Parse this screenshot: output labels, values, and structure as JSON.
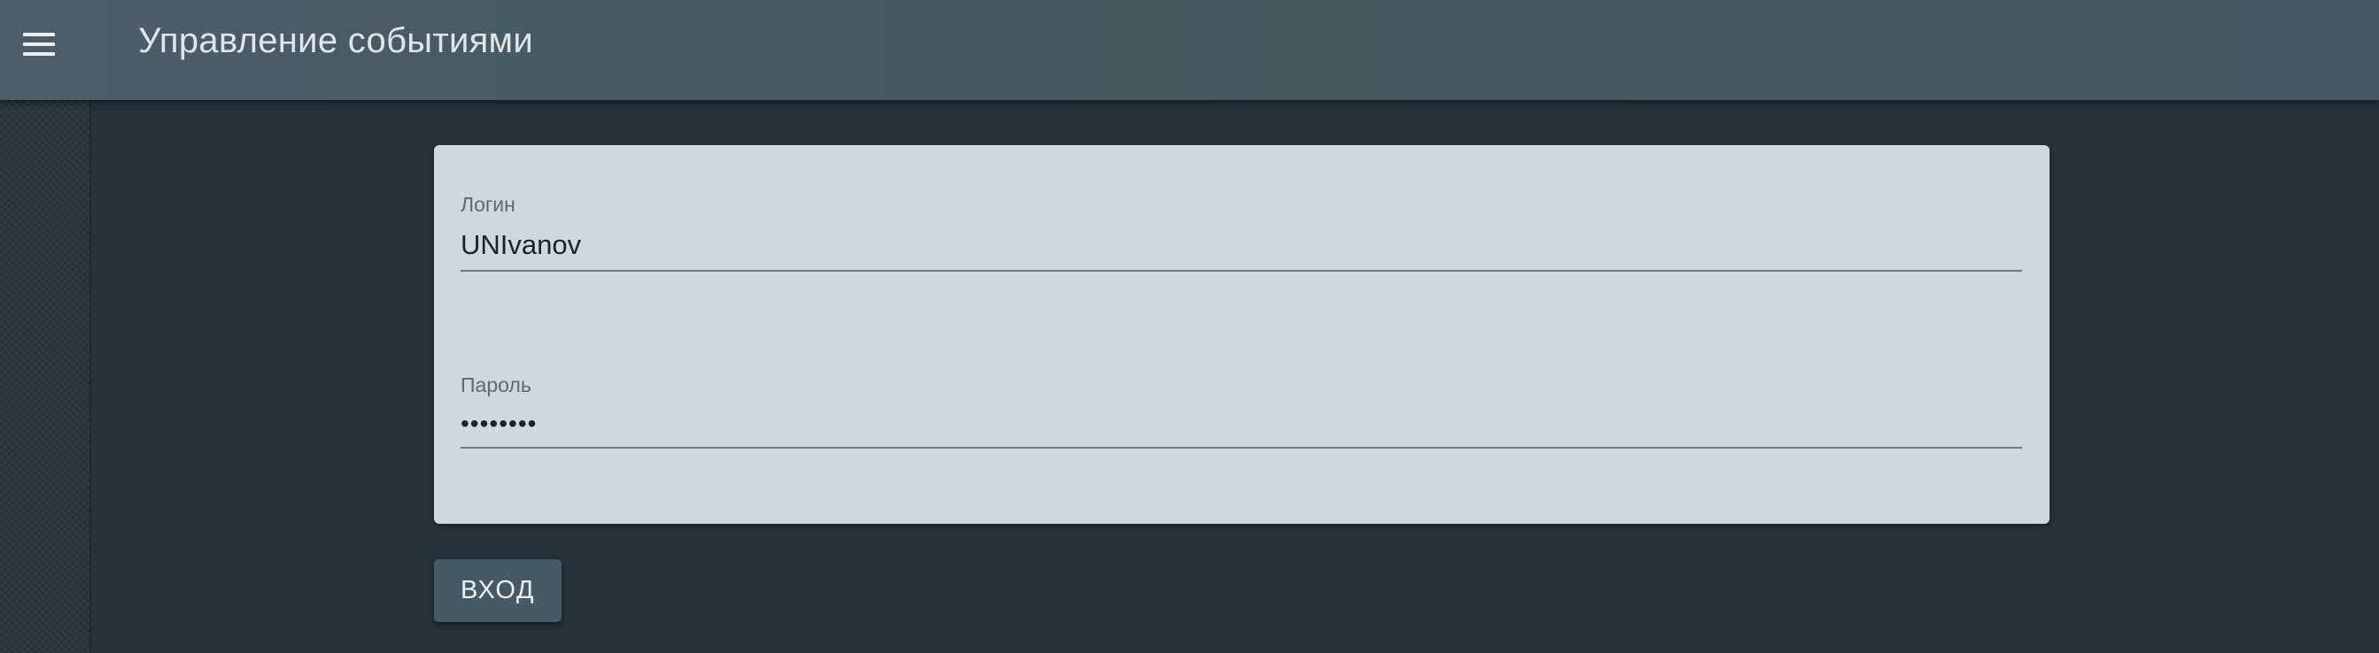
{
  "header": {
    "title": "Управление событиями",
    "menu_icon": "hamburger-menu-icon"
  },
  "login_form": {
    "login_label": "Логин",
    "login_value": "UNIvanov",
    "password_label": "Пароль",
    "password_value": "••••••••",
    "submit_label": "ВХОД"
  },
  "colors": {
    "app_bar": "#455a64",
    "background": "#263238",
    "card": "#cfd8dc",
    "button": "#455a64"
  }
}
